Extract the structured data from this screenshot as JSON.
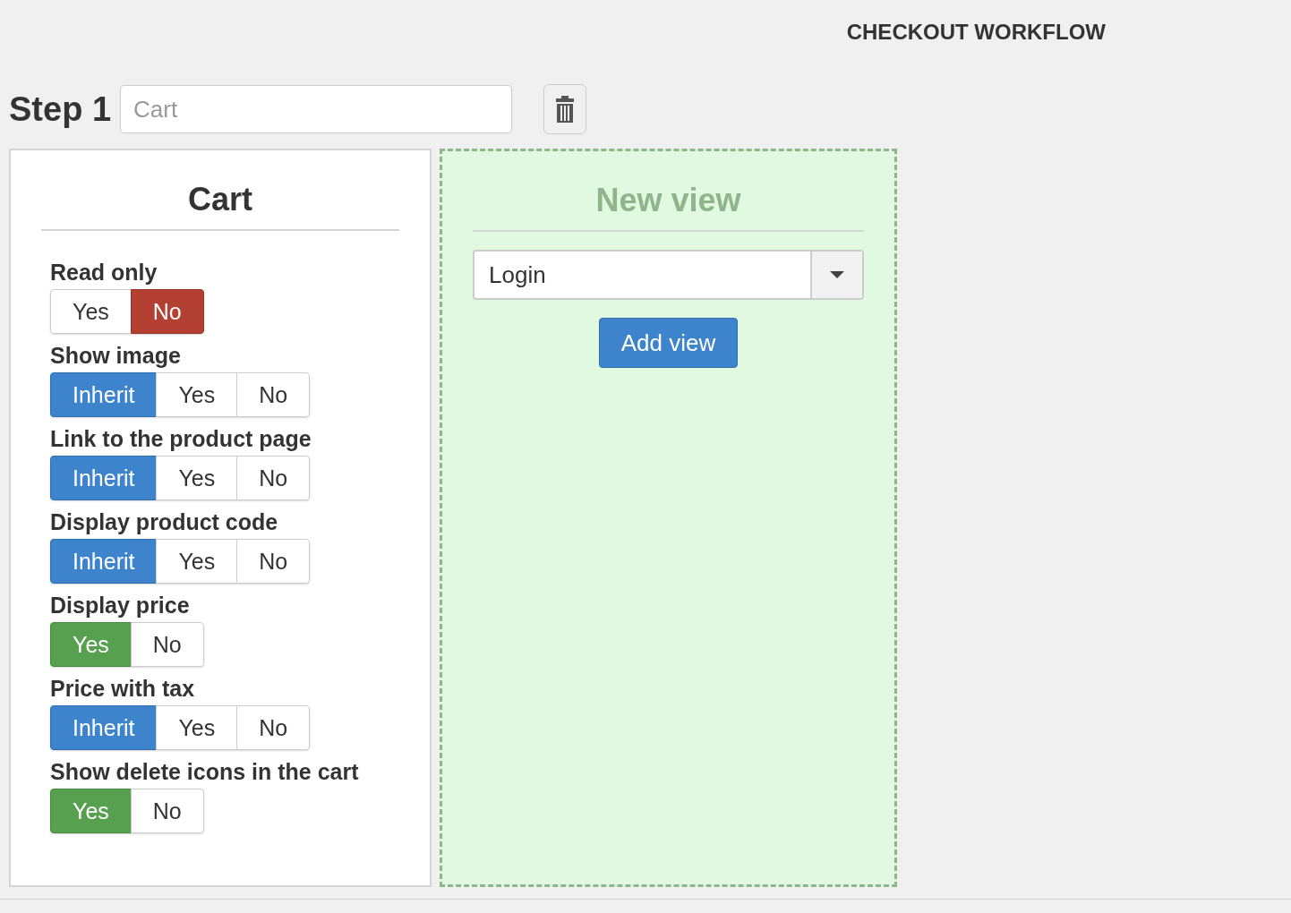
{
  "header": {
    "title": "CHECKOUT WORKFLOW"
  },
  "step": {
    "label": "Step 1",
    "placeholder": "Cart"
  },
  "cart_panel": {
    "title": "Cart",
    "settings": [
      {
        "label": "Read only",
        "options": [
          {
            "label": "Yes",
            "kind": "yes",
            "selected": false
          },
          {
            "label": "No",
            "kind": "no",
            "selected": true
          }
        ]
      },
      {
        "label": "Show image",
        "options": [
          {
            "label": "Inherit",
            "kind": "inherit",
            "selected": true
          },
          {
            "label": "Yes",
            "kind": "yes",
            "selected": false
          },
          {
            "label": "No",
            "kind": "no",
            "selected": false
          }
        ]
      },
      {
        "label": "Link to the product page",
        "options": [
          {
            "label": "Inherit",
            "kind": "inherit",
            "selected": true
          },
          {
            "label": "Yes",
            "kind": "yes",
            "selected": false
          },
          {
            "label": "No",
            "kind": "no",
            "selected": false
          }
        ]
      },
      {
        "label": "Display product code",
        "options": [
          {
            "label": "Inherit",
            "kind": "inherit",
            "selected": true
          },
          {
            "label": "Yes",
            "kind": "yes",
            "selected": false
          },
          {
            "label": "No",
            "kind": "no",
            "selected": false
          }
        ]
      },
      {
        "label": "Display price",
        "options": [
          {
            "label": "Yes",
            "kind": "yes",
            "selected": true
          },
          {
            "label": "No",
            "kind": "no",
            "selected": false
          }
        ]
      },
      {
        "label": "Price with tax",
        "options": [
          {
            "label": "Inherit",
            "kind": "inherit",
            "selected": true
          },
          {
            "label": "Yes",
            "kind": "yes",
            "selected": false
          },
          {
            "label": "No",
            "kind": "no",
            "selected": false
          }
        ]
      },
      {
        "label": "Show delete icons in the cart",
        "options": [
          {
            "label": "Yes",
            "kind": "yes",
            "selected": true
          },
          {
            "label": "No",
            "kind": "no",
            "selected": false
          }
        ]
      }
    ]
  },
  "new_view_panel": {
    "title": "New view",
    "select_value": "Login",
    "button": "Add view"
  }
}
